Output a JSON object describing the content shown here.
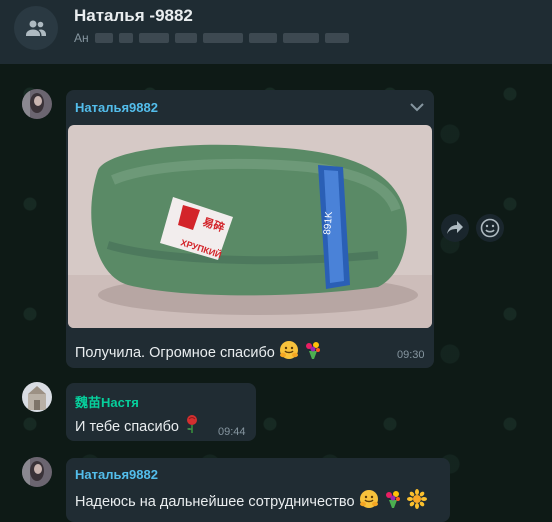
{
  "header": {
    "title": "Наталья -9882",
    "subtitle_lead": "Ан"
  },
  "messages": [
    {
      "sender": "Наталья9882",
      "sender_color": "#53bdeb",
      "text": "Получила. Огромное спасибо",
      "emojis": [
        "hugging-face",
        "bouquet"
      ],
      "time": "09:30",
      "has_image": true,
      "image_label_cn": "易碎",
      "image_label_ru": "ХРУПКИЙ",
      "image_tape_text": "891K"
    },
    {
      "sender": "魏苗Настя",
      "sender_color": "#06cf9c",
      "text": "И тебе спасибо",
      "emojis": [
        "rose"
      ],
      "time": "09:44"
    },
    {
      "sender": "Наталья9882",
      "sender_color": "#53bdeb",
      "text": "Надеюсь на дальнейшее сотрудничество",
      "emojis": [
        "hugging-face",
        "bouquet",
        "sunflower"
      ]
    }
  ],
  "colors": {
    "header_bg": "#1f2c33",
    "bubble_bg": "#202c33",
    "chat_bg": "#0e1a16"
  }
}
